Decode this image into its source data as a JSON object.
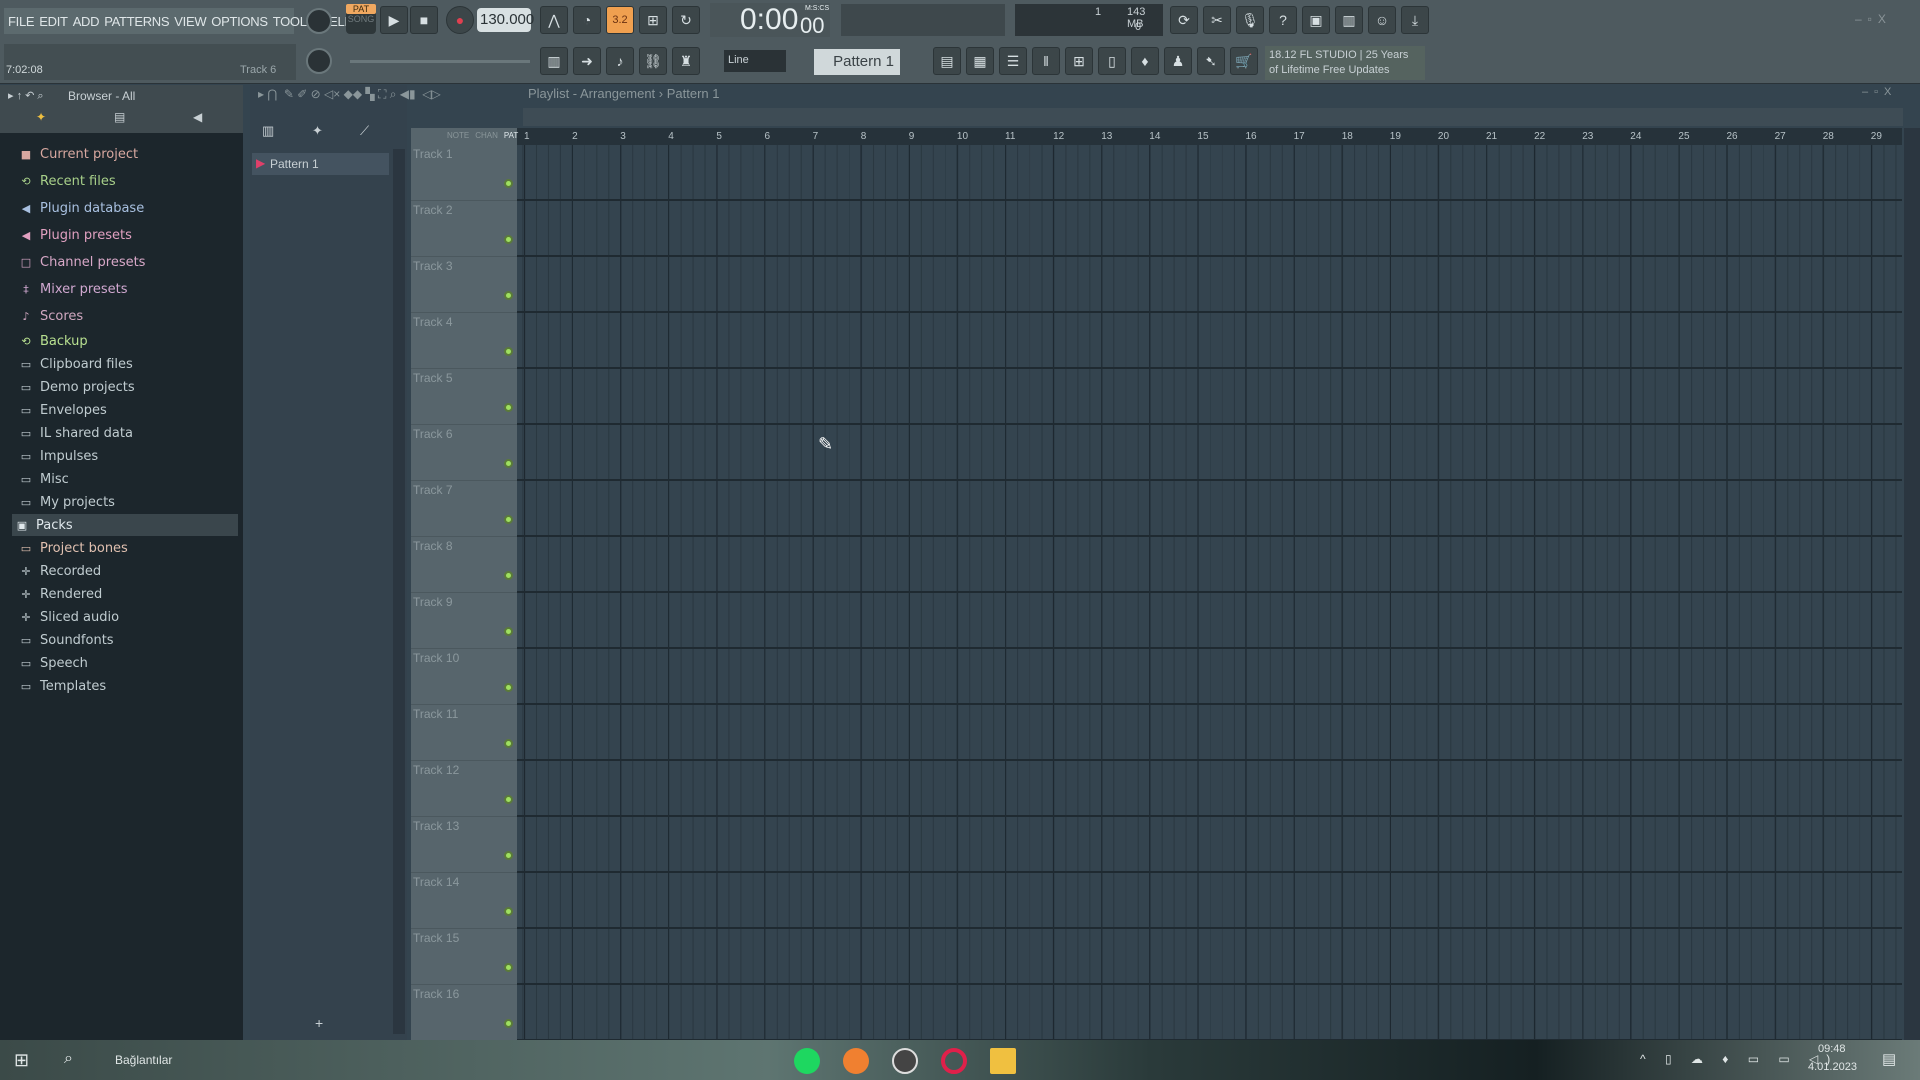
{
  "menu": [
    "FILE",
    "EDIT",
    "ADD",
    "PATTERNS",
    "VIEW",
    "OPTIONS",
    "TOOLS",
    "HELP"
  ],
  "hint": {
    "time": "7:02:08",
    "target": "Track 6"
  },
  "transport": {
    "pat": "PAT",
    "song": "SONG",
    "tempo": "130.000",
    "time": "0:00",
    "time_small": "00",
    "time_format": "M:S:CS",
    "step_label": "3.2"
  },
  "cpu": {
    "voices": "1",
    "memory": "143 MB",
    "poly": "0"
  },
  "snap": "Line",
  "pattern": "Pattern 1",
  "news": {
    "line1": "18.12  FL STUDIO | 25 Years",
    "line2": "of Lifetime Free Updates"
  },
  "browser": {
    "title": "Browser - All",
    "items": [
      {
        "label": "Current project",
        "color": "#d8a8a0",
        "icon": "■"
      },
      {
        "label": "Recent files",
        "color": "#a8d08a",
        "icon": "⟲"
      },
      {
        "label": "Plugin database",
        "color": "#a8c0e0",
        "icon": "◀"
      },
      {
        "label": "Plugin presets",
        "color": "#e0a0c0",
        "icon": "◀"
      },
      {
        "label": "Channel presets",
        "color": "#d8a8c8",
        "icon": "□"
      },
      {
        "label": "Mixer presets",
        "color": "#d0a8d0",
        "icon": "‡"
      },
      {
        "label": "Scores",
        "color": "#d0a8c0",
        "icon": "♪"
      },
      {
        "label": "Backup",
        "color": "#b8e090",
        "icon": "⟲"
      },
      {
        "label": "Clipboard files",
        "color": "#c0ccd0",
        "icon": "▭"
      },
      {
        "label": "Demo projects",
        "color": "#c0ccd0",
        "icon": "▭"
      },
      {
        "label": "Envelopes",
        "color": "#c0ccd0",
        "icon": "▭"
      },
      {
        "label": "IL shared data",
        "color": "#c0ccd0",
        "icon": "▭"
      },
      {
        "label": "Impulses",
        "color": "#c0ccd0",
        "icon": "▭"
      },
      {
        "label": "Misc",
        "color": "#c0ccd0",
        "icon": "▭"
      },
      {
        "label": "My projects",
        "color": "#c0ccd0",
        "icon": "▭"
      },
      {
        "label": "Packs",
        "color": "#e0e8ec",
        "icon": "▣",
        "selected": true
      },
      {
        "label": "Project bones",
        "color": "#e0c0b0",
        "icon": "▭"
      },
      {
        "label": "Recorded",
        "color": "#c0ccd0",
        "icon": "✛"
      },
      {
        "label": "Rendered",
        "color": "#c0ccd0",
        "icon": "✛"
      },
      {
        "label": "Sliced audio",
        "color": "#c0ccd0",
        "icon": "✛"
      },
      {
        "label": "Soundfonts",
        "color": "#c0ccd0",
        "icon": "▭"
      },
      {
        "label": "Speech",
        "color": "#c0ccd0",
        "icon": "▭"
      },
      {
        "label": "Templates",
        "color": "#c0ccd0",
        "icon": "▭"
      }
    ]
  },
  "playlist": {
    "title": "Playlist - Arrangement",
    "pattern": "Pattern 1",
    "modes": [
      "NOTE",
      "CHAN",
      "PAT"
    ],
    "patterns": [
      "Pattern 1"
    ],
    "add": "+",
    "bars": [
      "1",
      "2",
      "3",
      "4",
      "5",
      "6",
      "7",
      "8",
      "9",
      "10",
      "11",
      "12",
      "13",
      "14",
      "15",
      "16",
      "17",
      "18",
      "19",
      "20",
      "21",
      "22",
      "23",
      "24",
      "25",
      "26",
      "27",
      "28",
      "29"
    ],
    "tracks": [
      "Track 1",
      "Track 2",
      "Track 3",
      "Track 4",
      "Track 5",
      "Track 6",
      "Track 7",
      "Track 8",
      "Track 9",
      "Track 10",
      "Track 11",
      "Track 12",
      "Track 13",
      "Track 14",
      "Track 15",
      "Track 16"
    ]
  },
  "taskbar": {
    "search_label": "Bağlantılar",
    "clock": "09:48",
    "date": "4.01.2023"
  }
}
